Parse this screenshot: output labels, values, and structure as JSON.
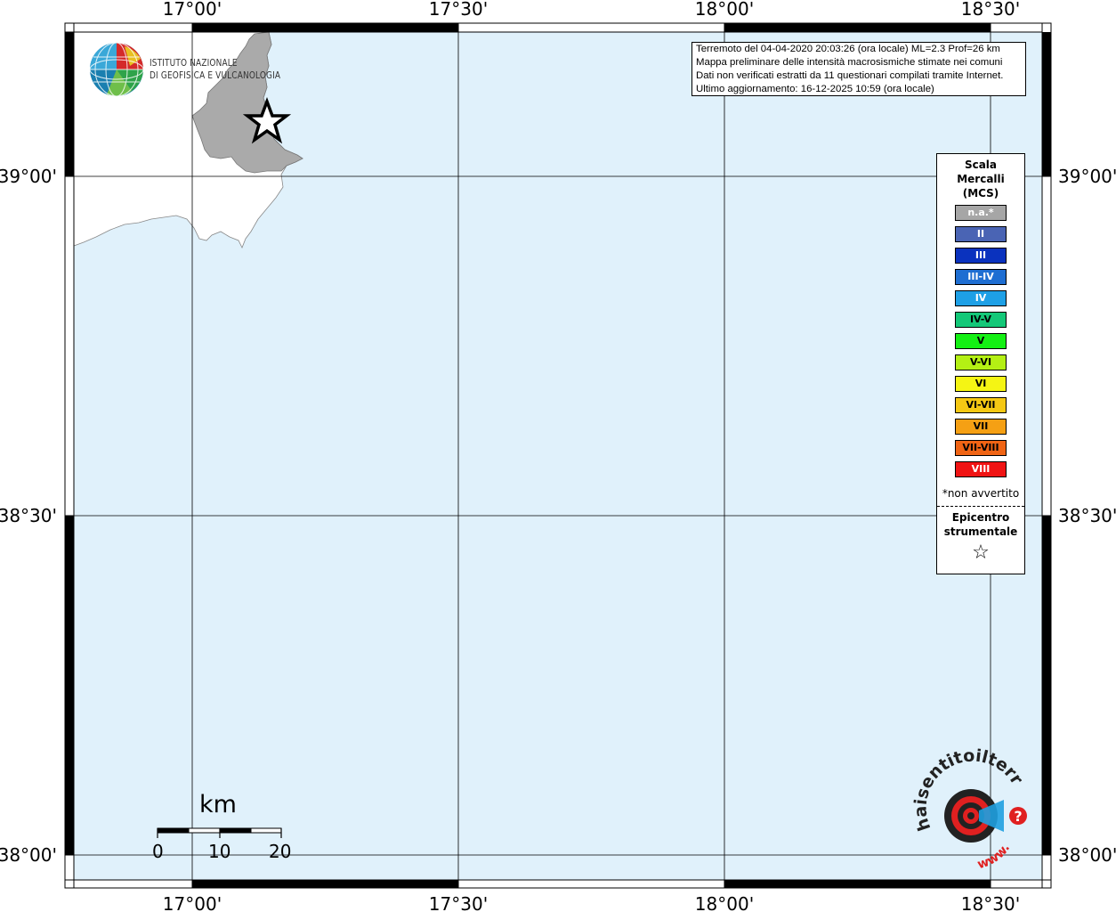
{
  "map": {
    "sea_color": "#e0f1fb",
    "land_color": "#ffffff",
    "felt_area_color": "#aaaaaa",
    "grid_color": "#000000",
    "longitude_ticks": [
      "17°00'",
      "17°30'",
      "18°00'",
      "18°30'"
    ],
    "latitude_ticks": [
      "39°00'",
      "38°30'",
      "38°00'"
    ],
    "epicenter_icon": "star-icon"
  },
  "logo": {
    "line1": "ISTITUTO NAZIONALE",
    "line2": "DI GEOFISICA E VULCANOLOGIA",
    "icon": "ingv-globe-icon"
  },
  "info": {
    "line1": "Terremoto del 04-04-2020 20:03:26 (ora locale) ML=2.3 Prof=26 km",
    "line2": "Mappa preliminare delle intensità macrosismiche stimate nei comuni",
    "line3": "Dati non verificati estratti da 11 questionari compilati tramite Internet.",
    "line4": "Ultimo aggiornamento: 16-12-2025 10:59 (ora locale)"
  },
  "legend": {
    "title1": "Scala",
    "title2": "Mercalli",
    "title3": "(MCS)",
    "classes": [
      {
        "label": "n.a.*",
        "color": "#a6a6a6",
        "text_color": "#ffffff"
      },
      {
        "label": "II",
        "color": "#4a64b4",
        "text_color": "#ffffff"
      },
      {
        "label": "III",
        "color": "#0a32be",
        "text_color": "#ffffff"
      },
      {
        "label": "III-IV",
        "color": "#1e6ed2",
        "text_color": "#ffffff"
      },
      {
        "label": "IV",
        "color": "#1ea0e6",
        "text_color": "#ffffff"
      },
      {
        "label": "IV-V",
        "color": "#14c878",
        "text_color": "#000000"
      },
      {
        "label": "V",
        "color": "#14f014",
        "text_color": "#000000"
      },
      {
        "label": "V-VI",
        "color": "#b4f014",
        "text_color": "#000000"
      },
      {
        "label": "VI",
        "color": "#f5f514",
        "text_color": "#000000"
      },
      {
        "label": "VI-VII",
        "color": "#f5c814",
        "text_color": "#000000"
      },
      {
        "label": "VII",
        "color": "#f5a014",
        "text_color": "#000000"
      },
      {
        "label": "VII-VIII",
        "color": "#f06414",
        "text_color": "#000000"
      },
      {
        "label": "VIII",
        "color": "#f01414",
        "text_color": "#ffffff"
      }
    ],
    "note": "*non avvertito",
    "epicenter_line1": "Epicentro",
    "epicenter_line2": "strumentale",
    "epicenter_symbol": "☆"
  },
  "scale_bar": {
    "unit": "km",
    "labels": [
      "0",
      "10",
      "20"
    ]
  },
  "badge": {
    "text_top": "haisentitoilterremoto.it",
    "text_bottom": "www.",
    "question_mark": "?",
    "icon": "haisentito-target-icon"
  }
}
